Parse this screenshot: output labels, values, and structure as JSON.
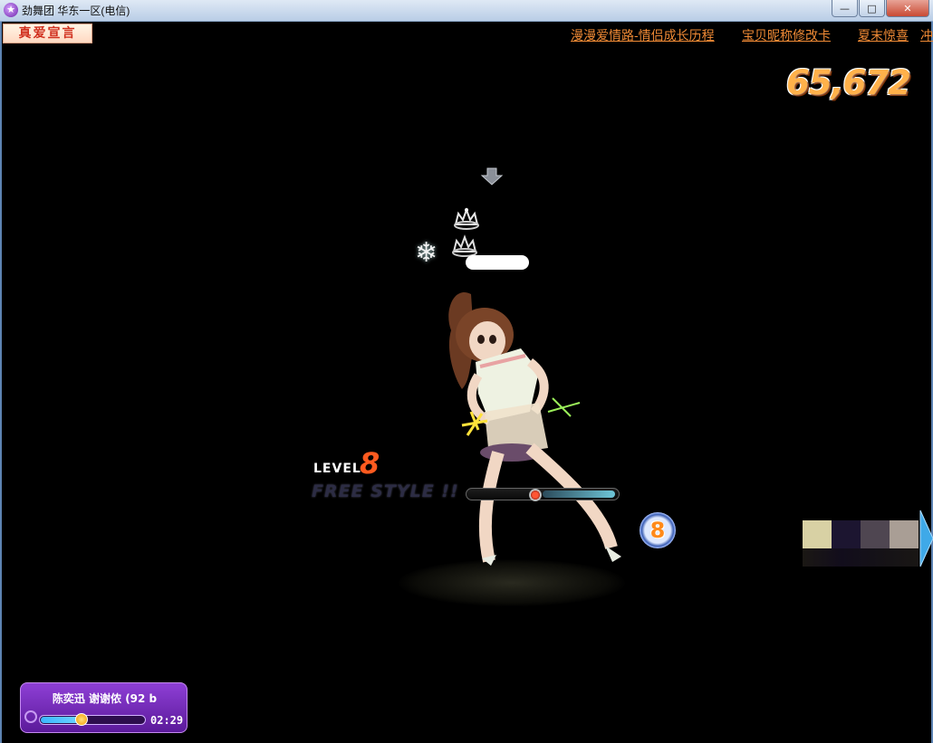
{
  "window": {
    "title": "劲舞团 华东一区(电信)",
    "app_icon": "app-logo-icon",
    "controls": {
      "minimize": "—",
      "maximize": "□",
      "close": "✕"
    }
  },
  "banner": {
    "love_button": "真爱宣言",
    "links": [
      "漫漫爱情路-情侣成长历程",
      "宝贝昵称修改卡",
      "夏末惊喜",
      "冲"
    ]
  },
  "score": "65,672",
  "stage": {
    "level_label": "LEVEL",
    "level_value": "8",
    "mode": "FREE STYLE !!",
    "combo": "8",
    "icons": [
      "down-arrow-icon",
      "crown-icon",
      "crown-icon",
      "snowflake-icon"
    ],
    "swatch_colors": [
      "#d8d1a4",
      "#1c1530",
      "#4f4651",
      "#a99e95"
    ]
  },
  "music": {
    "song": "陈奕迅 谢谢侬 (92 b",
    "time": "02:29",
    "progress": 0.4,
    "accent": "#8e3fd6"
  }
}
